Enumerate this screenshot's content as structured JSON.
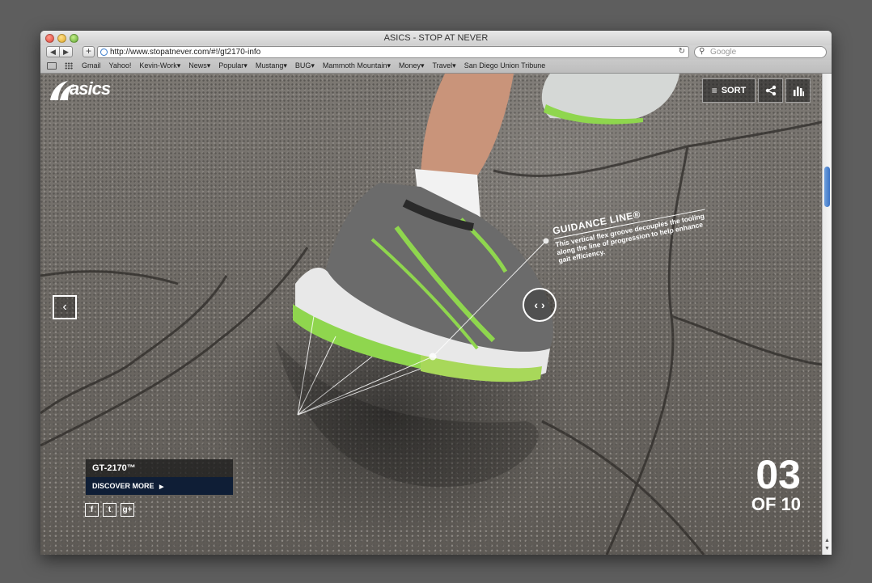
{
  "window": {
    "title": "ASICS - STOP AT NEVER"
  },
  "toolbar": {
    "back_label": "◀",
    "forward_label": "▶",
    "add_label": "+",
    "url": "http://www.stopatnever.com/#!/gt2170-info",
    "search_placeholder": "Google"
  },
  "bookmarks": [
    "Gmail",
    "Yahoo!",
    "Kevin-Work▾",
    "News▾",
    "Popular▾",
    "Mustang▾",
    "BUG▾",
    "Mammoth Mountain▾",
    "Money▾",
    "Travel▾",
    "San Diego Union Tribune"
  ],
  "page": {
    "logo": "asics",
    "sort_label": "SORT",
    "guidance": {
      "title": "GUIDANCE LINE®",
      "description": "This vertical flex groove decouples the tooling along the line of progression to help enhance gait efficiency."
    },
    "product": {
      "name": "GT-2170™",
      "cta": "DISCOVER MORE"
    },
    "socials": [
      "f",
      "t",
      "g+"
    ],
    "counter": {
      "current": "03",
      "total": "OF 10"
    }
  },
  "colors": {
    "shoe_green": "#8fd64e",
    "shoe_gray": "#6b6b6b",
    "cta_navy": "#0f1e36",
    "desktop": "#5e5e5e"
  }
}
